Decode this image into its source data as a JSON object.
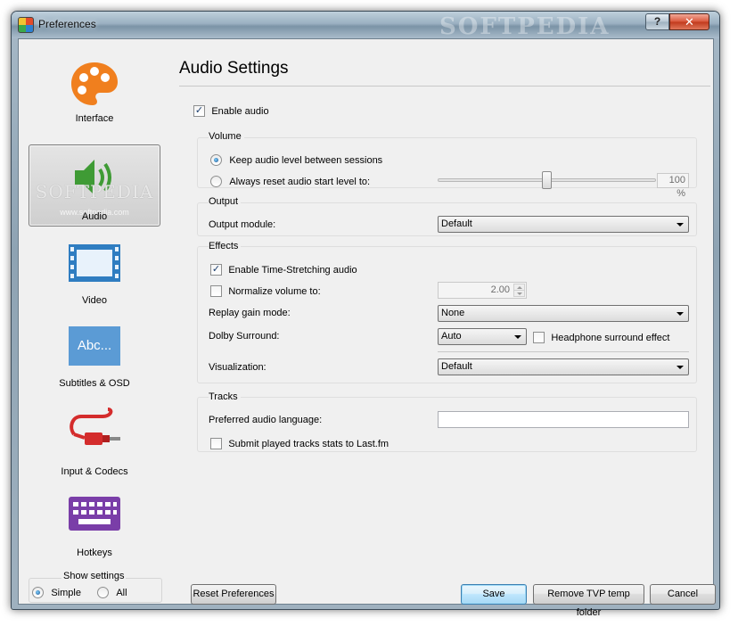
{
  "window": {
    "title": "Preferences",
    "watermark": "SOFTPEDIA",
    "help_label": "?",
    "close_label": "✕"
  },
  "sidebar": {
    "items": [
      {
        "label": "Interface",
        "icon": "palette-icon"
      },
      {
        "label": "Audio",
        "icon": "speaker-icon",
        "selected": true
      },
      {
        "label": "Video",
        "icon": "film-icon"
      },
      {
        "label": "Subtitles & OSD",
        "icon": "subtitles-icon",
        "icon_text": "Abc..."
      },
      {
        "label": "Input & Codecs",
        "icon": "cable-icon"
      },
      {
        "label": "Hotkeys",
        "icon": "keyboard-icon"
      }
    ],
    "watermark": "SOFTPEDIA",
    "watermark_url": "www.softpedia.com",
    "show_settings": {
      "legend": "Show settings",
      "options": [
        "Simple",
        "All"
      ],
      "selected": "Simple"
    }
  },
  "main": {
    "heading": "Audio Settings",
    "enable_audio": {
      "label": "Enable audio",
      "checked": true
    },
    "volume": {
      "title": "Volume",
      "keep_level": "Keep audio level between sessions",
      "always_reset": "Always reset audio start level to:",
      "selected": "keep",
      "level_percent": "100 %",
      "slider_fraction": 0.5
    },
    "output": {
      "title": "Output",
      "module_label": "Output module:",
      "module_value": "Default"
    },
    "effects": {
      "title": "Effects",
      "time_stretch": {
        "label": "Enable Time-Stretching audio",
        "checked": true
      },
      "normalize": {
        "label": "Normalize volume to:",
        "checked": false,
        "value": "2.00"
      },
      "replay_gain_label": "Replay gain mode:",
      "replay_gain_value": "None",
      "dolby_label": "Dolby Surround:",
      "dolby_value": "Auto",
      "headphone": {
        "label": "Headphone surround effect",
        "checked": false
      },
      "visualization_label": "Visualization:",
      "visualization_value": "Default"
    },
    "tracks": {
      "title": "Tracks",
      "language_label": "Preferred audio language:",
      "language_value": "",
      "lastfm": {
        "label": "Submit played tracks stats to Last.fm",
        "checked": false
      }
    }
  },
  "buttons": {
    "reset": "Reset Preferences",
    "save": "Save",
    "remove_temp": "Remove TVP temp folder",
    "cancel": "Cancel"
  },
  "colors": {
    "accent_orange": "#f07f1e",
    "accent_green": "#3f9b35",
    "accent_blue": "#2f7dc1",
    "accent_red": "#d42c2c",
    "accent_purple": "#7a3ea8"
  }
}
